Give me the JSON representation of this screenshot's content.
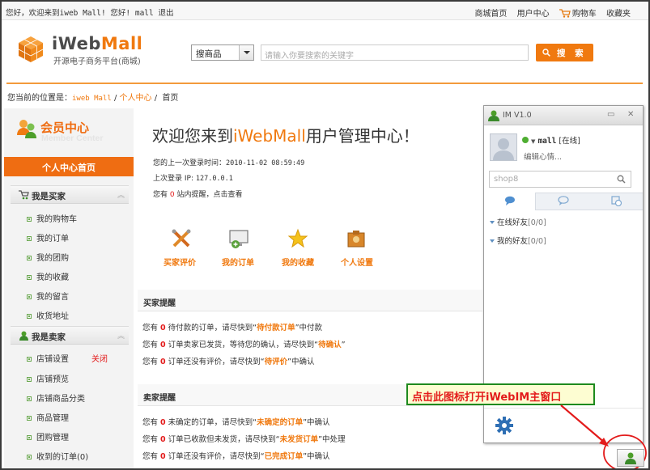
{
  "topbar": {
    "greeting": "您好，欢迎来到iweb Mall!  您好! mall 退出",
    "links": [
      "商城首页",
      "用户中心",
      "购物车",
      "收藏夹"
    ]
  },
  "logo": {
    "title_a": "iWeb",
    "title_b": "Mall",
    "subtitle": "开源电子商务平台(商城)"
  },
  "search": {
    "category": "搜商品",
    "placeholder": "请输入你要搜索的关键字",
    "button": "搜 索"
  },
  "breadcrumb": {
    "prefix": "您当前的位置是：",
    "site": "iweb Mall",
    "sep": " / ",
    "center": "个人中心",
    "sep2": " /  ",
    "current": "首页"
  },
  "sidebar": {
    "title": "会员中心",
    "title_en": "Member Center",
    "home": "个人中心首页",
    "buyer_title": "我是买家",
    "buyer_items": [
      "我的购物车",
      "我的订单",
      "我的团购",
      "我的收藏",
      "我的留言",
      "收货地址"
    ],
    "seller_title": "我是卖家",
    "seller_items": [
      "店铺设置",
      "店铺预览",
      "店铺商品分类",
      "商品管理",
      "团购管理",
      "收到的订单(0)"
    ],
    "seller_closed": "关闭"
  },
  "main": {
    "welcome_a": "欢迎您来到",
    "welcome_b": "iWebMall",
    "welcome_c": "用户管理中心！",
    "last_login_label": "您的上一次登录时间：",
    "last_login": "2010-11-02 08:59:49",
    "last_ip_label": "上次登录 IP: ",
    "last_ip": "127.0.0.1",
    "notice_a": "您有 ",
    "notice_num": "0",
    "notice_b": " 站内提醒，点击查看",
    "quick": [
      "买家评价",
      "我的订单",
      "我的收藏",
      "个人设置"
    ],
    "buyer_panel": "买家提醒",
    "buyer_rows": [
      {
        "a": "您有",
        "n": "0",
        "b": "待付款的订单，请尽快到“",
        "q": "待付款订单",
        "c": "”中付款"
      },
      {
        "a": "您有",
        "n": "0",
        "b": "订单卖家已发货，等待您的确认，请尽快到“",
        "q": "待确认",
        "c": "”"
      },
      {
        "a": "您有",
        "n": "0",
        "b": "订单还没有评价，请尽快到“",
        "q": "待评价",
        "c": "”中确认"
      }
    ],
    "seller_panel": "卖家提醒",
    "seller_rows": [
      {
        "a": "您有",
        "n": "0",
        "b": "未确定的订单，请尽快到“",
        "q": "未确定的订单",
        "c": "”中确认"
      },
      {
        "a": "您有",
        "n": "0",
        "b": "订单已收款但未发货，请尽快到“",
        "q": "未发货订单",
        "c": "”中处理"
      },
      {
        "a": "您有",
        "n": "0",
        "b": "订单还没有评价，请尽快到“",
        "q": "已完成订单",
        "c": "”中确认"
      }
    ]
  },
  "im": {
    "title": "IM V1.0",
    "user": "mall",
    "status": "[在线]",
    "signature": "编辑心情...",
    "search_placeholder": "shop8",
    "groups": [
      {
        "name": "在线好友",
        "count": "[0/0]"
      },
      {
        "name": "我的好友",
        "count": "[0/0]"
      }
    ]
  },
  "callout": "点击此图标打开iWebIM主窗口",
  "colors": {
    "accent": "#f0790f",
    "red": "#e31b1b",
    "green": "#1e8a1e"
  }
}
